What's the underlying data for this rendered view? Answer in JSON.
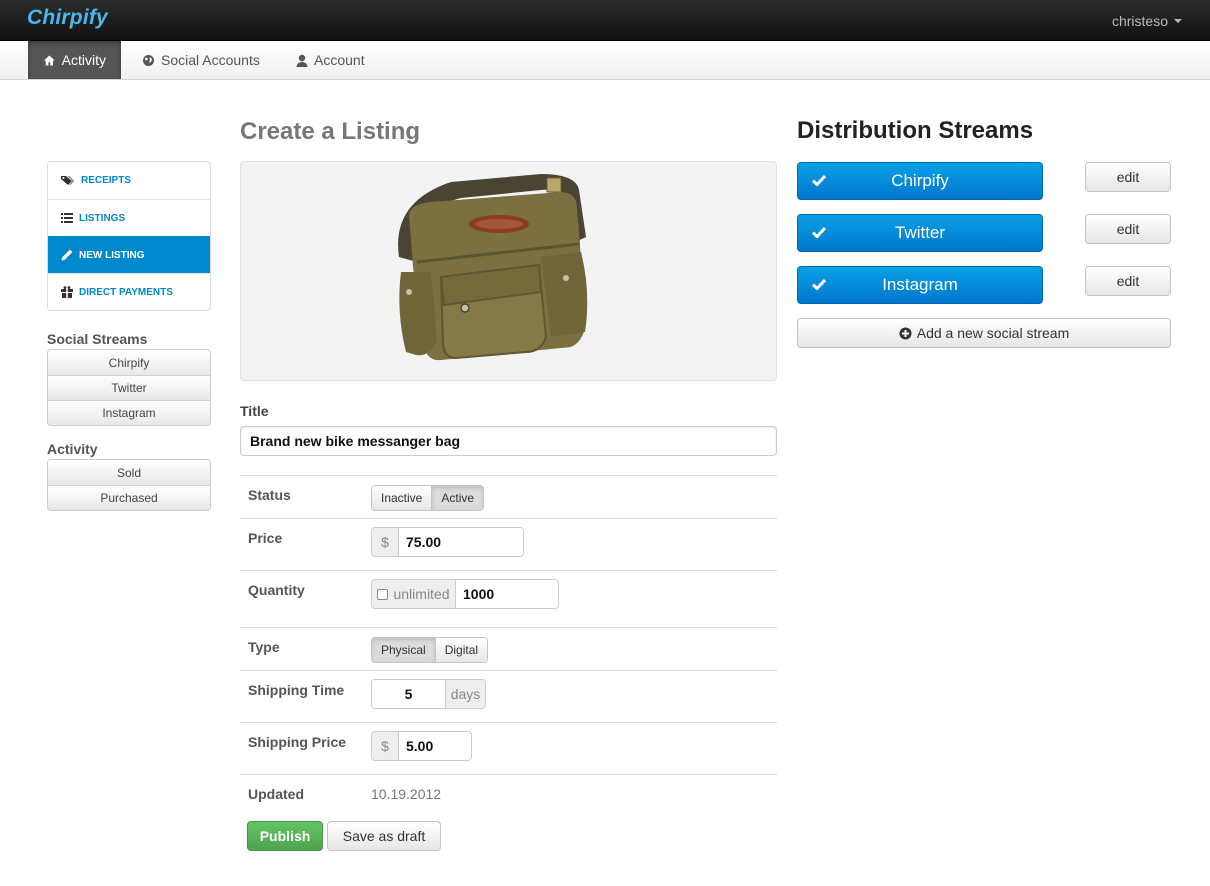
{
  "app": {
    "logo": "Chirpify",
    "user": "christeso"
  },
  "subnav": {
    "tabs": [
      {
        "label": "Activity",
        "icon": "home-icon",
        "active": true
      },
      {
        "label": "Social Accounts",
        "icon": "globe-icon",
        "active": false
      },
      {
        "label": "Account",
        "icon": "user-icon",
        "active": false
      }
    ]
  },
  "sidebar": {
    "items": [
      {
        "label": "RECEIPTS",
        "icon": "tags-icon",
        "active": false
      },
      {
        "label": "LISTINGS",
        "icon": "list-icon",
        "active": false
      },
      {
        "label": "NEW LISTING",
        "icon": "pencil-icon",
        "active": true
      },
      {
        "label": "DIRECT PAYMENTS",
        "icon": "gift-icon",
        "active": false
      }
    ],
    "social_heading": "Social Streams",
    "social": [
      "Chirpify",
      "Twitter",
      "Instagram"
    ],
    "activity_heading": "Activity",
    "activity": [
      "Sold",
      "Purchased"
    ]
  },
  "form": {
    "page_title": "Create a Listing",
    "title_label": "Title",
    "title_value": "Brand new bike messanger bag",
    "status_label": "Status",
    "status_options": [
      "Inactive",
      "Active"
    ],
    "status_selected": "Active",
    "price_label": "Price",
    "currency": "$",
    "price_value": "75.00",
    "quantity_label": "Quantity",
    "unlimited_label": "unlimited",
    "quantity_value": "1000",
    "type_label": "Type",
    "type_options": [
      "Physical",
      "Digital"
    ],
    "type_selected": "Physical",
    "shipping_time_label": "Shipping Time",
    "shipping_time_value": "5",
    "shipping_time_unit": "days",
    "shipping_price_label": "Shipping Price",
    "shipping_price_value": "5.00",
    "updated_label": "Updated",
    "updated_value": "10.19.2012",
    "publish_label": "Publish",
    "draft_label": "Save as draft"
  },
  "distribution": {
    "title": "Distribution Streams",
    "streams": [
      "Chirpify",
      "Twitter",
      "Instagram"
    ],
    "edit_label": "edit",
    "add_label": "Add a new social stream"
  },
  "colors": {
    "primary": "#0088cc",
    "success": "#51a351",
    "logo": "#48b8ec"
  }
}
